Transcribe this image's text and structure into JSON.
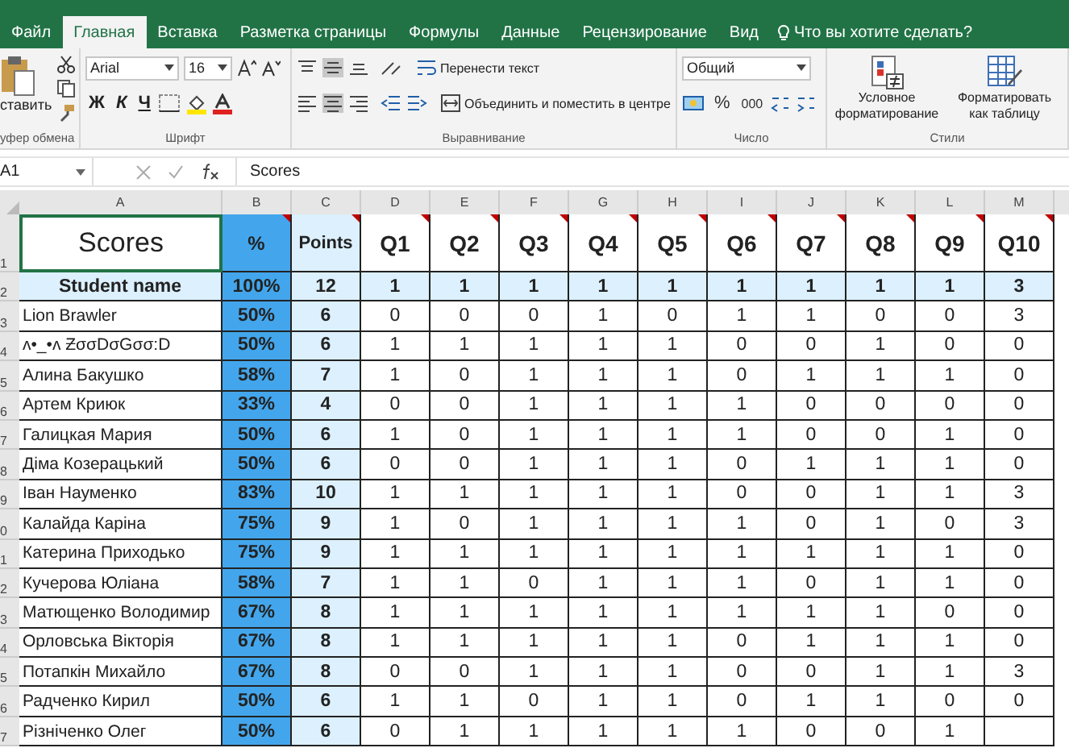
{
  "ribbon": {
    "tabs": [
      {
        "label": "Файл",
        "selected": false
      },
      {
        "label": "Главная",
        "selected": true
      },
      {
        "label": "Вставка",
        "selected": false
      },
      {
        "label": "Разметка страницы",
        "selected": false
      },
      {
        "label": "Формулы",
        "selected": false
      },
      {
        "label": "Данные",
        "selected": false
      },
      {
        "label": "Рецензирование",
        "selected": false
      },
      {
        "label": "Вид",
        "selected": false
      }
    ],
    "tell_me": "Что вы хотите сделать?",
    "clipboard": {
      "paste": "ставить",
      "group": "уфер обмена"
    },
    "font": {
      "name": "Arial",
      "size": "16",
      "bold": "Ж",
      "italic": "К",
      "underline": "Ч",
      "group": "Шрифт"
    },
    "alignment": {
      "wrap": "Перенести текст",
      "merge": "Объединить и поместить в центре",
      "group": "Выравнивание"
    },
    "number": {
      "format": "Общий",
      "percent": "%",
      "thousands": "000",
      "group": "Число"
    },
    "styles": {
      "conditional": "Условное форматирование",
      "as_table": "Форматировать как таблицу",
      "group": "Стили"
    }
  },
  "formula_bar": {
    "name_box": "A1",
    "content": "Scores"
  },
  "sheet": {
    "columns": [
      "A",
      "B",
      "C",
      "D",
      "E",
      "F",
      "G",
      "H",
      "I",
      "J",
      "K",
      "L",
      "M"
    ],
    "row_numbers": [
      "1",
      "2",
      "3",
      "4",
      "5",
      "6",
      "7",
      "8",
      "9",
      "0",
      "1",
      "2",
      "3",
      "4",
      "5",
      "6",
      "7"
    ],
    "header": {
      "title": "Scores",
      "selected": true,
      "cells": [
        {
          "text": "%",
          "comment": true
        },
        {
          "text": "Points",
          "comment": true
        },
        {
          "text": "Q1",
          "comment": true
        },
        {
          "text": "Q2",
          "comment": true
        },
        {
          "text": "Q3",
          "comment": true
        },
        {
          "text": "Q4",
          "comment": true
        },
        {
          "text": "Q5",
          "comment": true
        },
        {
          "text": "Q6",
          "comment": true
        },
        {
          "text": "Q7",
          "comment": true
        },
        {
          "text": "Q8",
          "comment": true
        },
        {
          "text": "Q9",
          "comment": true
        },
        {
          "text": "Q10",
          "comment": true
        }
      ]
    },
    "max_row": {
      "cells": [
        "Student name",
        "100%",
        "12",
        "1",
        "1",
        "1",
        "1",
        "1",
        "1",
        "1",
        "1",
        "1",
        "3"
      ]
    },
    "rows": [
      {
        "cells": [
          "Lion Brawler",
          "50%",
          "6",
          "0",
          "0",
          "0",
          "1",
          "0",
          "1",
          "1",
          "0",
          "0",
          "3"
        ]
      },
      {
        "cells": [
          "ʌ•_•ʌ ƵσσDσGσσ:D",
          "50%",
          "6",
          "1",
          "1",
          "1",
          "1",
          "1",
          "0",
          "0",
          "1",
          "0",
          "0"
        ]
      },
      {
        "cells": [
          "Алина Бакушко",
          "58%",
          "7",
          "1",
          "0",
          "1",
          "1",
          "1",
          "0",
          "1",
          "1",
          "1",
          "0"
        ]
      },
      {
        "cells": [
          "Артем Криюк",
          "33%",
          "4",
          "0",
          "0",
          "1",
          "1",
          "1",
          "1",
          "0",
          "0",
          "0",
          "0"
        ]
      },
      {
        "cells": [
          "Галицкая Мария",
          "50%",
          "6",
          "1",
          "0",
          "1",
          "1",
          "1",
          "1",
          "0",
          "0",
          "1",
          "0"
        ]
      },
      {
        "cells": [
          "Діма Козерацький",
          "50%",
          "6",
          "0",
          "0",
          "1",
          "1",
          "1",
          "0",
          "1",
          "1",
          "1",
          "0"
        ]
      },
      {
        "cells": [
          "Іван Науменко",
          "83%",
          "10",
          "1",
          "1",
          "1",
          "1",
          "1",
          "0",
          "0",
          "1",
          "1",
          "3"
        ]
      },
      {
        "cells": [
          "Калайда Каріна",
          "75%",
          "9",
          "1",
          "0",
          "1",
          "1",
          "1",
          "1",
          "0",
          "1",
          "0",
          "3"
        ]
      },
      {
        "cells": [
          "Катерина Приходько",
          "75%",
          "9",
          "1",
          "1",
          "1",
          "1",
          "1",
          "1",
          "1",
          "1",
          "1",
          "0"
        ]
      },
      {
        "cells": [
          "Кучерова Юліана",
          "58%",
          "7",
          "1",
          "1",
          "0",
          "1",
          "1",
          "1",
          "0",
          "1",
          "1",
          "0"
        ]
      },
      {
        "cells": [
          "Матющенко Володимир",
          "67%",
          "8",
          "1",
          "1",
          "1",
          "1",
          "1",
          "1",
          "1",
          "1",
          "0",
          "0"
        ]
      },
      {
        "cells": [
          "Орловська Вікторія",
          "67%",
          "8",
          "1",
          "1",
          "1",
          "1",
          "1",
          "0",
          "1",
          "1",
          "1",
          "0"
        ]
      },
      {
        "cells": [
          "Потапкін Михайло",
          "67%",
          "8",
          "0",
          "0",
          "1",
          "1",
          "1",
          "0",
          "0",
          "1",
          "1",
          "3"
        ]
      },
      {
        "cells": [
          "Радченко Кирил",
          "50%",
          "6",
          "1",
          "1",
          "0",
          "1",
          "1",
          "0",
          "1",
          "1",
          "0",
          "0"
        ]
      },
      {
        "cells": [
          "Різніченко Олег",
          "50%",
          "6",
          "0",
          "1",
          "1",
          "1",
          "1",
          "1",
          "0",
          "0",
          "1",
          ""
        ]
      }
    ]
  }
}
